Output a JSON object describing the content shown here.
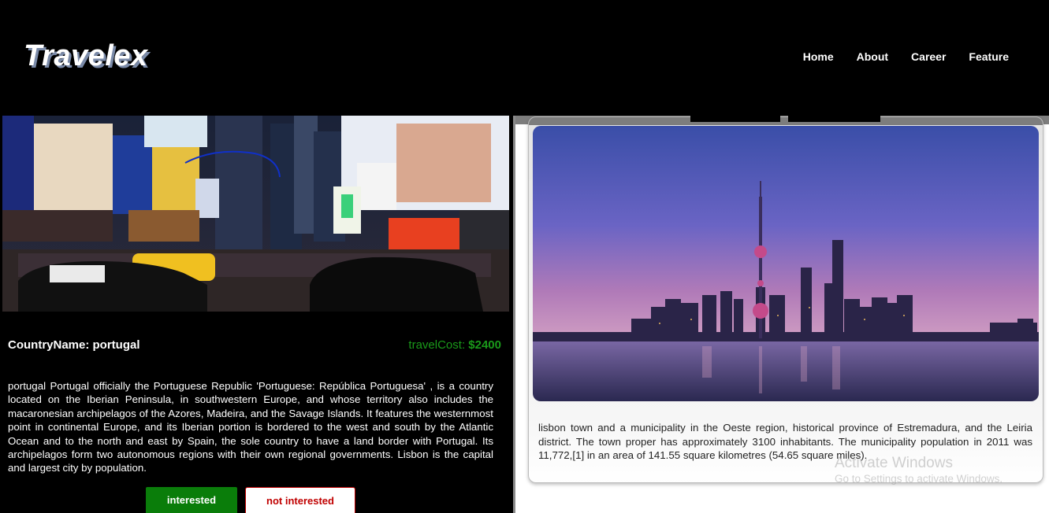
{
  "header": {
    "logo": "Travelex",
    "nav": [
      "Home",
      "About",
      "Career",
      "Feature"
    ]
  },
  "destination": {
    "country_label": "CountryName: portugal",
    "cost_label": "travelCost: ",
    "cost_value": "$2400",
    "description": "portugal Portugal officially the Portuguese Republic 'Portuguese: República Portuguesa' , is a country located on the Iberian Peninsula, in southwestern Europe, and whose territory also includes the macaronesian archipelagos of the Azores, Madeira, and the Savage Islands. It features the westernmost point in continental Europe, and its Iberian portion is bordered to the west and south by the Atlantic Ocean and to the north and east by Spain, the sole country to have a land border with Portugal. Its archipelagos form two autonomous regions with their own regional governments. Lisbon is the capital and largest city by population.",
    "interested_label": "interested",
    "not_interested_label": "not interested"
  },
  "card": {
    "description": "lisbon town and a municipality in the Oeste region, historical province of Estremadura, and the Leiria district. The town proper has approximately 3100 inhabitants. The municipality population in 2011 was 11,772,[1] in an area of 141.55 square kilometres (54.65 square miles)."
  },
  "watermark": {
    "title": "Activate Windows",
    "subtitle": "Go to Settings to activate Windows."
  },
  "colors": {
    "header_bg": "#000000",
    "accent_green": "#0a7d0a",
    "accent_red": "#c00000",
    "cost_green": "#1a9a1a"
  }
}
